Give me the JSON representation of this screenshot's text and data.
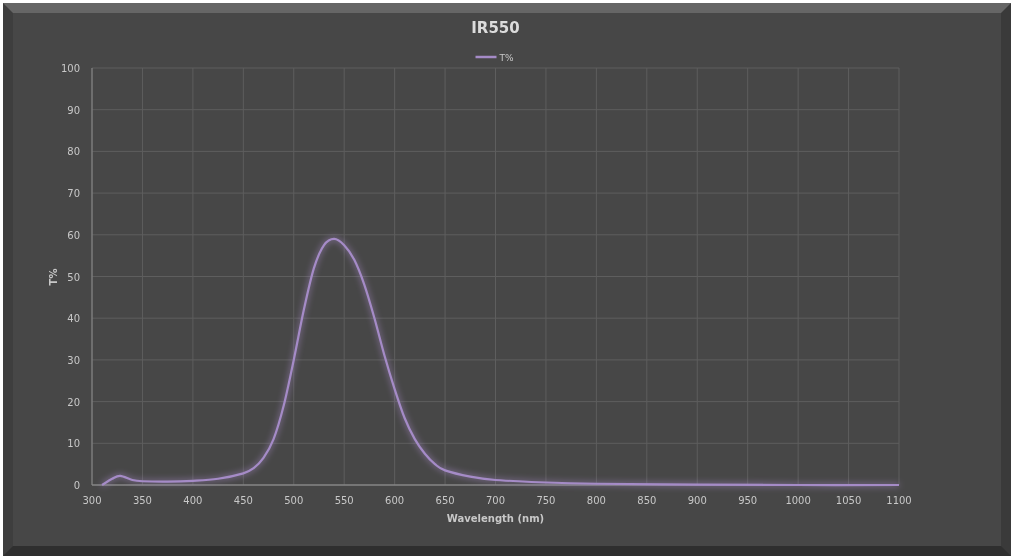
{
  "chart": {
    "chart_data": {
      "type": "line",
      "title": "IR550",
      "xlabel": "Wavelength (nm)",
      "ylabel": "T%",
      "x": [
        310,
        320,
        328,
        340,
        350,
        375,
        400,
        425,
        450,
        460,
        470,
        480,
        490,
        500,
        510,
        520,
        530,
        540,
        550,
        560,
        570,
        580,
        590,
        600,
        610,
        620,
        630,
        640,
        650,
        675,
        700,
        750,
        800,
        900,
        1000,
        1100
      ],
      "series": [
        {
          "name": "T%",
          "color": "#a58bc7",
          "values": [
            0,
            1.5,
            2.2,
            1.2,
            0.9,
            0.8,
            1.0,
            1.5,
            2.8,
            4,
            6.5,
            11,
            19,
            30,
            42,
            52,
            57.5,
            59,
            57.5,
            54,
            48,
            40,
            31,
            23,
            16,
            11,
            7.5,
            5,
            3.5,
            2,
            1.2,
            0.6,
            0.3,
            0.1,
            0,
            0
          ]
        }
      ],
      "grid": true,
      "xlim": [
        300,
        1100
      ],
      "ylim": [
        0,
        100
      ],
      "xticks": [
        300,
        350,
        400,
        450,
        500,
        550,
        600,
        650,
        700,
        750,
        800,
        850,
        900,
        950,
        1000,
        1050,
        1100
      ],
      "yticks": [
        0,
        10,
        20,
        30,
        40,
        50,
        60,
        70,
        80,
        90,
        100
      ]
    }
  }
}
